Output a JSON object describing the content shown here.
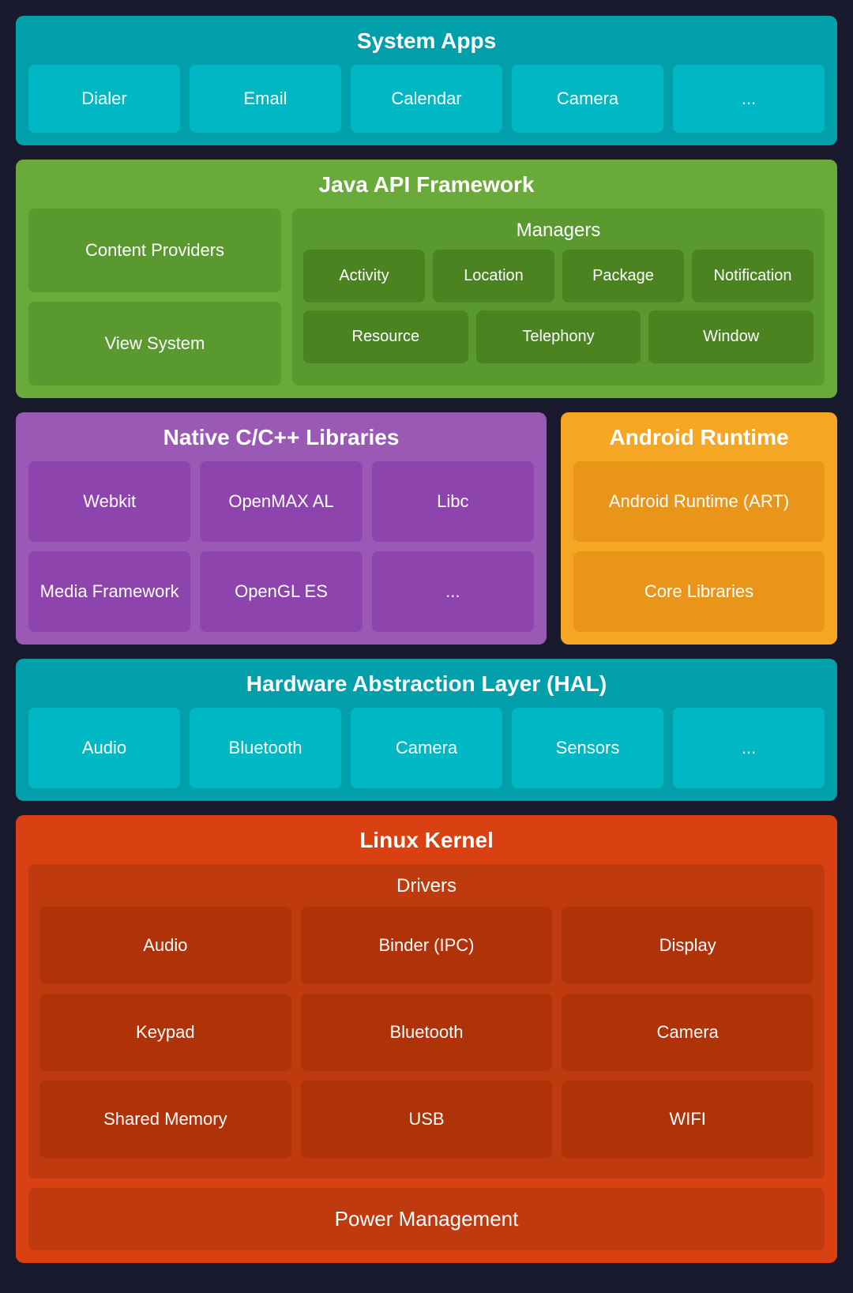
{
  "systemApps": {
    "title": "System Apps",
    "items": [
      "Dialer",
      "Email",
      "Calendar",
      "Camera",
      "..."
    ]
  },
  "javaApi": {
    "title": "Java API Framework",
    "left": {
      "contentProviders": "Content Providers",
      "viewSystem": "View System"
    },
    "managers": {
      "title": "Managers",
      "row1": [
        "Activity",
        "Location",
        "Package",
        "Notification"
      ],
      "row2": [
        "Resource",
        "Telephony",
        "Window"
      ]
    }
  },
  "nativeLibs": {
    "title": "Native C/C++ Libraries",
    "items": [
      "Webkit",
      "OpenMAX AL",
      "Libc",
      "Media Framework",
      "OpenGL ES",
      "..."
    ]
  },
  "androidRuntime": {
    "title": "Android Runtime",
    "items": [
      "Android Runtime (ART)",
      "Core Libraries"
    ]
  },
  "hal": {
    "title": "Hardware Abstraction Layer (HAL)",
    "items": [
      "Audio",
      "Bluetooth",
      "Camera",
      "Sensors",
      "..."
    ]
  },
  "linuxKernel": {
    "title": "Linux Kernel",
    "drivers": {
      "title": "Drivers",
      "row1": [
        "Audio",
        "Binder (IPC)",
        "Display"
      ],
      "row2": [
        "Keypad",
        "Bluetooth",
        "Camera"
      ],
      "row3": [
        "Shared Memory",
        "USB",
        "WIFI"
      ]
    },
    "powerManagement": "Power Management"
  }
}
